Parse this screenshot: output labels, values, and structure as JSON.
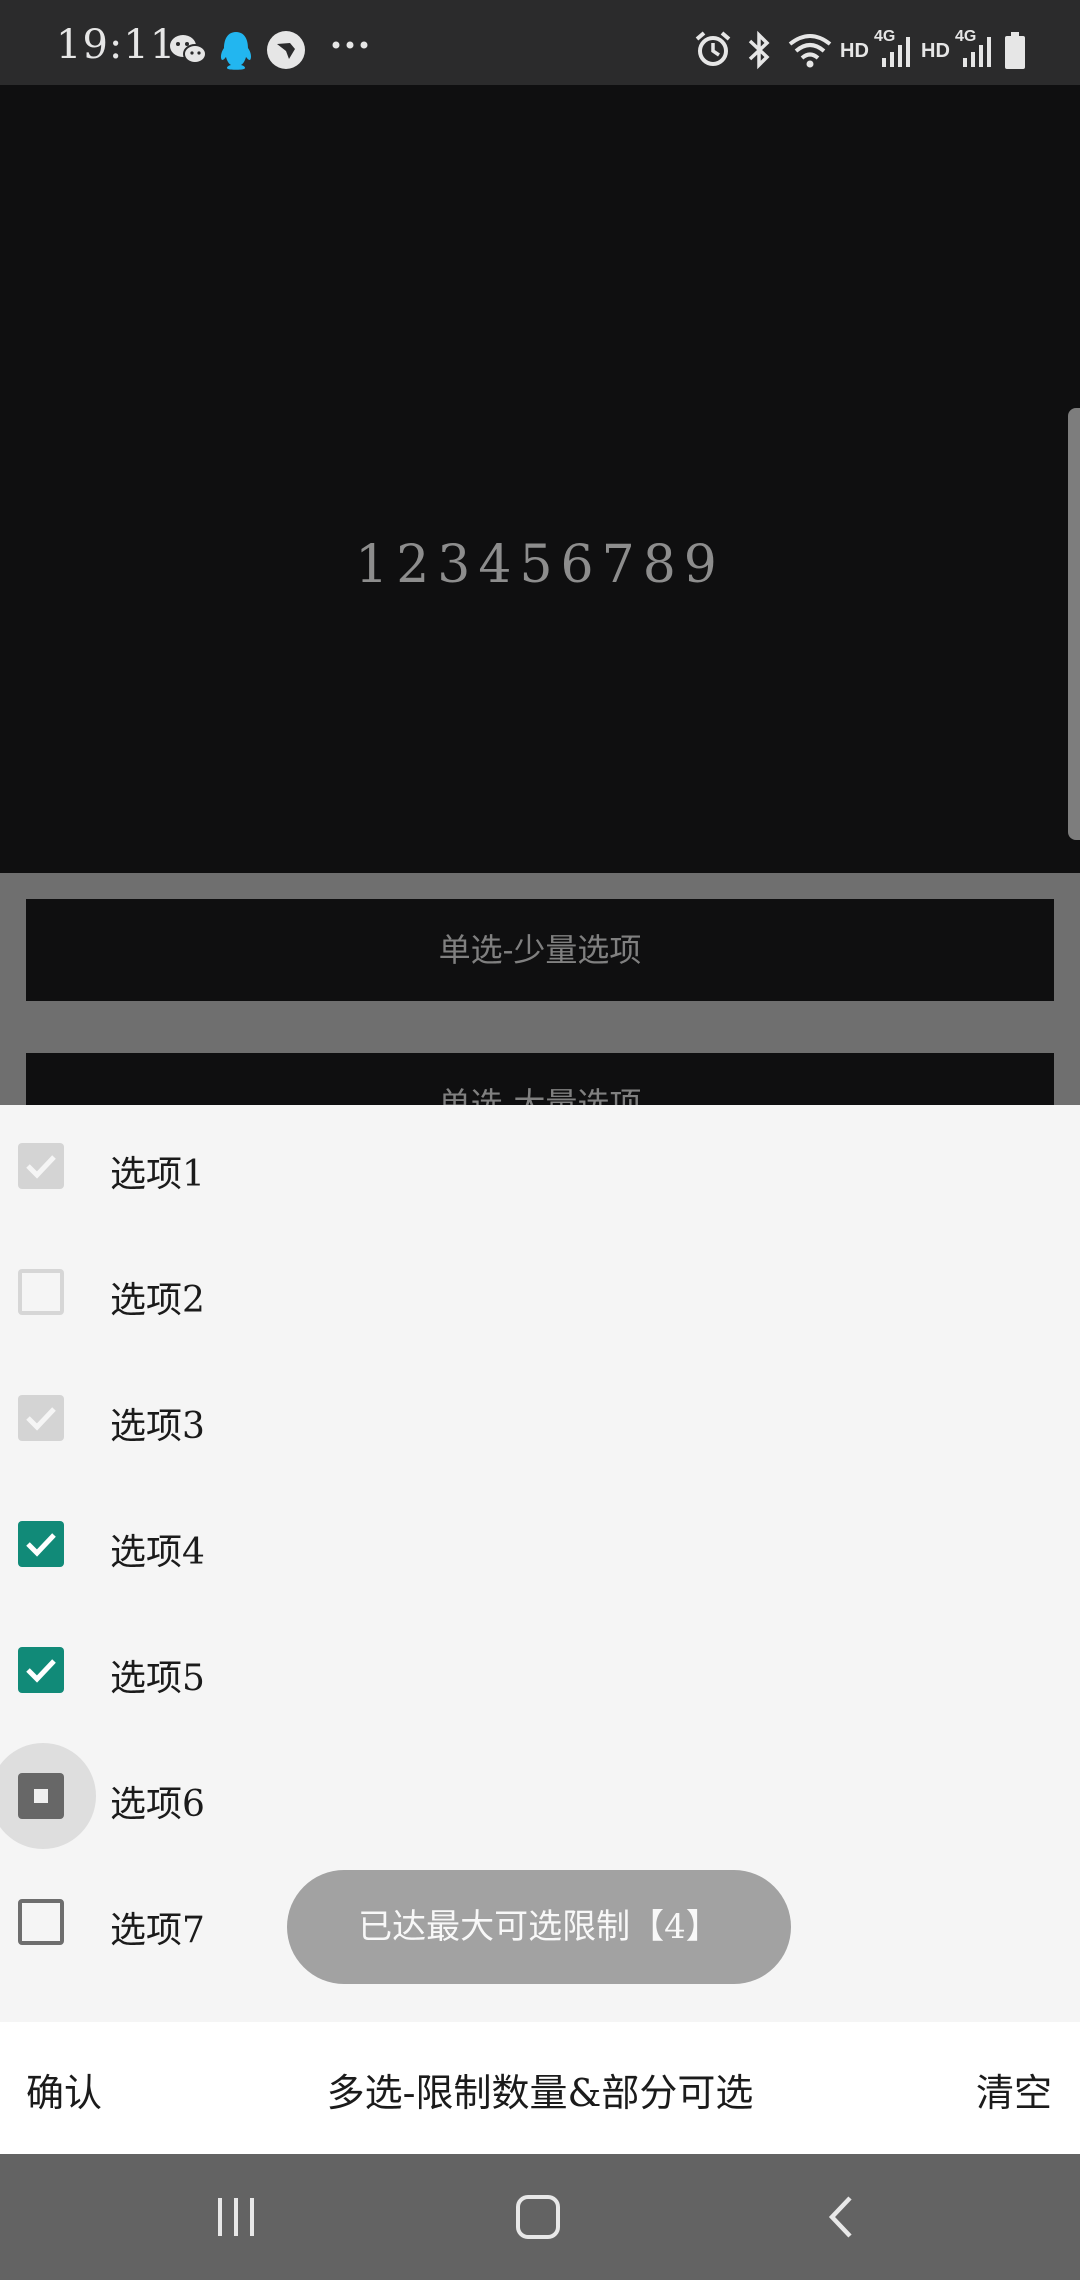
{
  "status_bar": {
    "time": "19:11",
    "notification_icons": [
      "wechat-icon",
      "qq-icon",
      "feishu-icon",
      "more-dots-icon"
    ],
    "system_icons": [
      "alarm-icon",
      "bluetooth-icon",
      "wifi-icon",
      "signal-icon",
      "signal-icon",
      "battery-icon"
    ],
    "hd1": "HD",
    "net1": "4G",
    "hd2": "HD",
    "net2": "4G"
  },
  "hero": {
    "display_text": "123456789"
  },
  "buttons": {
    "single_few": "单选-少量选项",
    "single_many": "单选-大量选项"
  },
  "sheet": {
    "options": [
      {
        "label": "选项1",
        "state": "checked-disabled"
      },
      {
        "label": "选项2",
        "state": "unchecked-disabled"
      },
      {
        "label": "选项3",
        "state": "checked-disabled"
      },
      {
        "label": "选项4",
        "state": "checked"
      },
      {
        "label": "选项5",
        "state": "checked"
      },
      {
        "label": "选项6",
        "state": "indeterminate"
      },
      {
        "label": "选项7",
        "state": "unchecked"
      }
    ],
    "toast": "已达最大可选限制【4】"
  },
  "action_bar": {
    "confirm_label": "确认",
    "title": "多选-限制数量&部分可选",
    "clear_label": "清空"
  },
  "nav_bar": {
    "buttons": [
      "recent-apps-icon",
      "home-icon",
      "back-icon"
    ]
  },
  "colors": {
    "accent": "#118a78",
    "toast_bg": "#a2a2a2",
    "sheet_bg": "#f5f5f5"
  }
}
